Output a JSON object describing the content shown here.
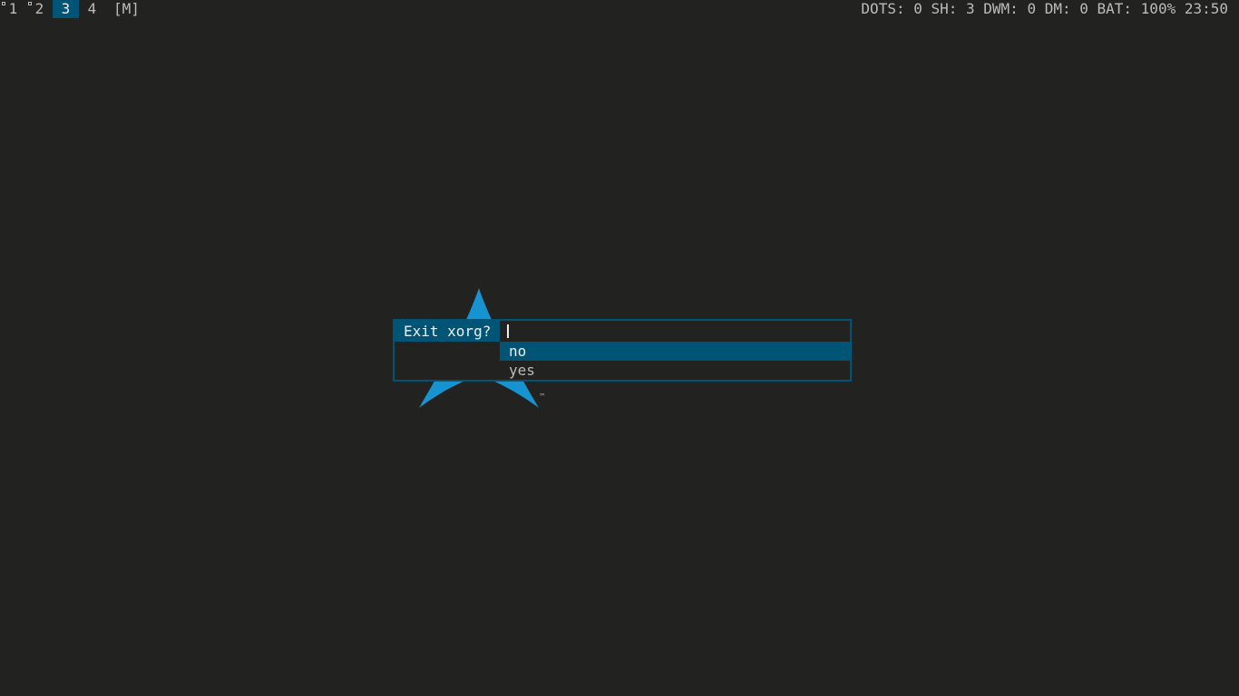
{
  "bar": {
    "tags": [
      {
        "label": "1",
        "occupied": true,
        "selected": false
      },
      {
        "label": "2",
        "occupied": true,
        "selected": false
      },
      {
        "label": "3",
        "occupied": false,
        "selected": true
      },
      {
        "label": "4",
        "occupied": false,
        "selected": false
      }
    ],
    "layout_symbol": "[M]",
    "status": "DOTS: 0 SH: 3 DWM: 0 DM: 0 BAT: 100% 23:50"
  },
  "prompt": {
    "label": "Exit xorg?",
    "input_value": "",
    "options": [
      "no",
      "yes"
    ],
    "selected_index": 0
  },
  "colors": {
    "background": "#222320",
    "accent": "#005577",
    "logo_blue": "#1793d1",
    "text": "#bbbbbb",
    "text_selected": "#eeeeee"
  },
  "icons": {
    "wallpaper_logo": "arch-linux-logo-icon",
    "trademark": "™"
  }
}
